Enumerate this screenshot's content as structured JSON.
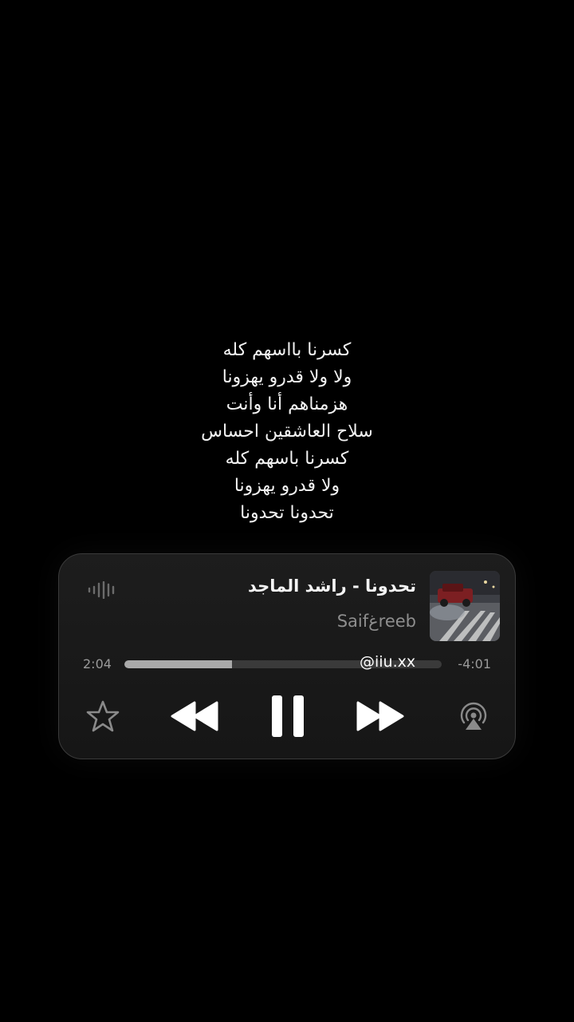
{
  "lyrics": [
    "كسرنا بااسهم كله",
    "ولا ولا قدرو يهزونا",
    "هزمناهم أنا وأنت",
    "سلاح العاشقين احساس",
    "كسرنا باسهم كله",
    "ولا قدرو يهزونا",
    "تحدونا تحدونا"
  ],
  "player": {
    "title": "تحدونا -  راشد الماجد",
    "artist": "Saifغreeb",
    "elapsed": "2:04",
    "remaining": "-4:01",
    "progress_fraction": 0.34,
    "watermark": "@iiu.xx",
    "icons": {
      "waveform": "waveform-icon",
      "star": "star-icon",
      "rewind": "rewind-icon",
      "pause": "pause-icon",
      "forward": "fast-forward-icon",
      "airplay": "airplay-icon"
    }
  },
  "colors": {
    "background": "#000000",
    "card": "#1b1b1b",
    "progress_fill": "#a9a9a9",
    "progress_track": "#3a3a3a",
    "muted_text": "#8e8e8e"
  }
}
